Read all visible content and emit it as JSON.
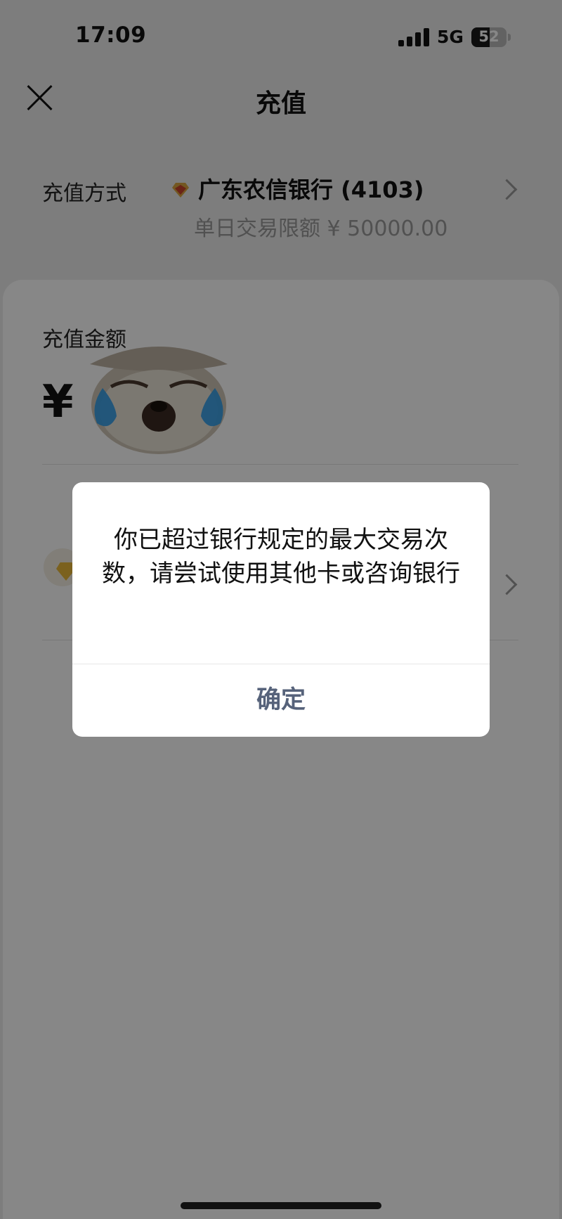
{
  "status_bar": {
    "time": "17:09",
    "network": "5G",
    "battery": "52",
    "battery_fraction": 0.52
  },
  "header": {
    "title": "充值"
  },
  "payment_method": {
    "label": "充值方式",
    "bank_name": "广东农信银行 (4103)",
    "limit": "单日交易限额 ¥ 50000.00"
  },
  "amount": {
    "label": "充值金额",
    "currency": "¥"
  },
  "dialog": {
    "message": "你已超过银行规定的最大交易次数，请尝试使用其他卡或咨询银行",
    "confirm_label": "确定"
  },
  "icons": [
    "close-icon",
    "signal-icon",
    "battery-icon",
    "bank-logo-icon",
    "chevron-right-icon",
    "diamond-icon",
    "crying-sloth-sticker"
  ],
  "colors": {
    "dialog_button": "#56627a",
    "overlay": "rgba(0,0,0,0.47)",
    "diamond": "#e8b83a"
  }
}
